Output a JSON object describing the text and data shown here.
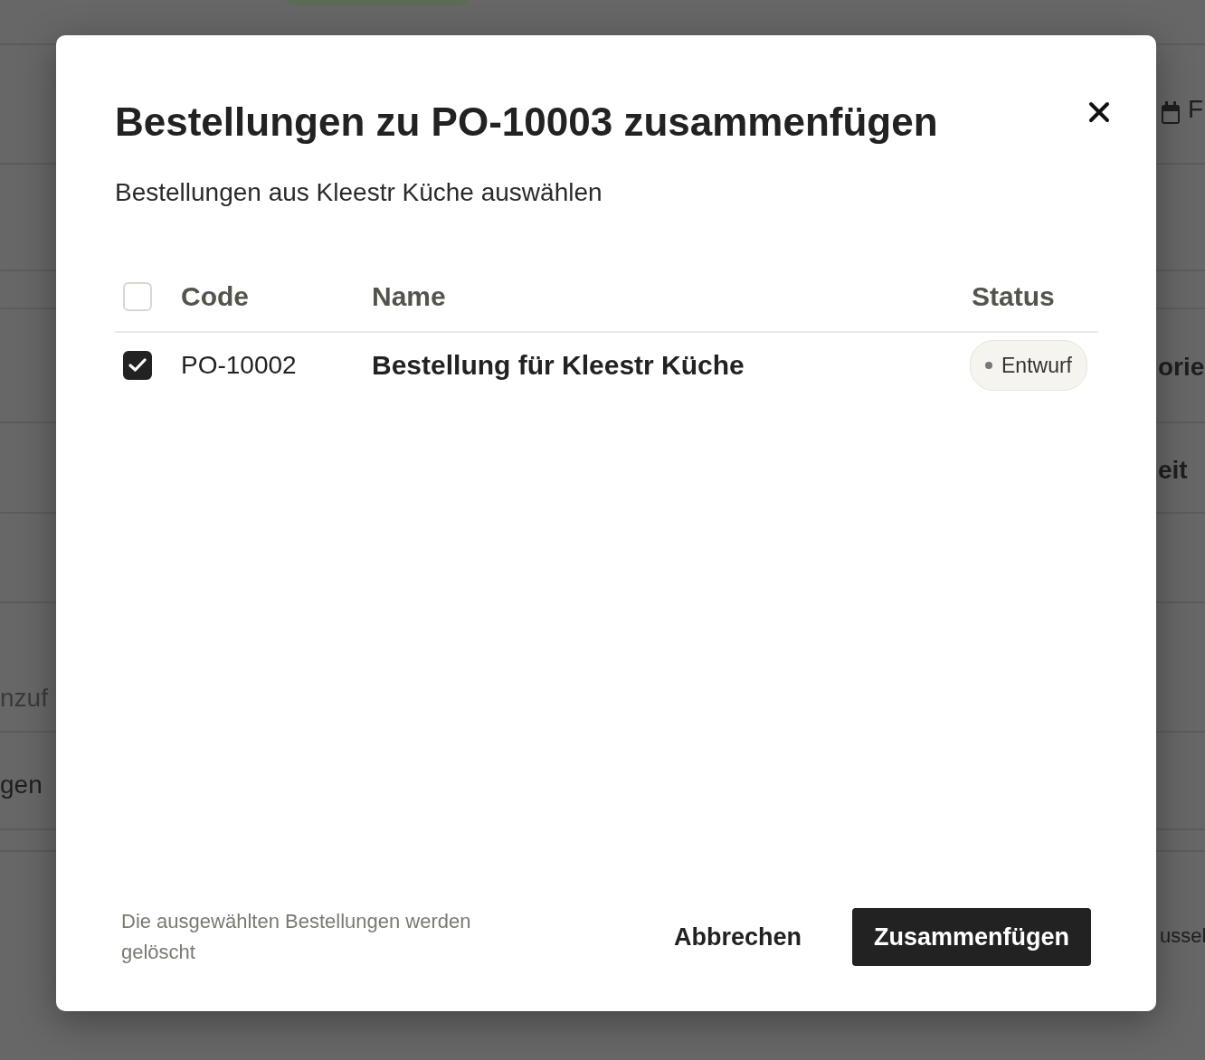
{
  "background": {
    "fragments": [
      {
        "text": "F"
      },
      {
        "text": "orie"
      },
      {
        "text": "eit"
      },
      {
        "text": "nzuf"
      },
      {
        "text": "gen"
      },
      {
        "text": "ussel"
      }
    ]
  },
  "dialog": {
    "title": "Bestellungen zu PO-10003 zusammenfügen",
    "subtitle": "Bestellungen aus Kleestr Küche auswählen",
    "table": {
      "select_all": {
        "checked": false
      },
      "columns": [
        "Code",
        "Name",
        "Status"
      ],
      "rows": [
        {
          "checked": true,
          "code": "PO-10002",
          "name": "Bestellung für Kleestr Küche",
          "status": "Entwurf"
        }
      ]
    },
    "footer": {
      "note": "Die ausgewählten Bestellungen werden gelöscht",
      "buttons": [
        {
          "label": "Abbrechen",
          "kind": "secondary"
        },
        {
          "label": "Zusammenfügen",
          "kind": "primary"
        }
      ]
    }
  }
}
